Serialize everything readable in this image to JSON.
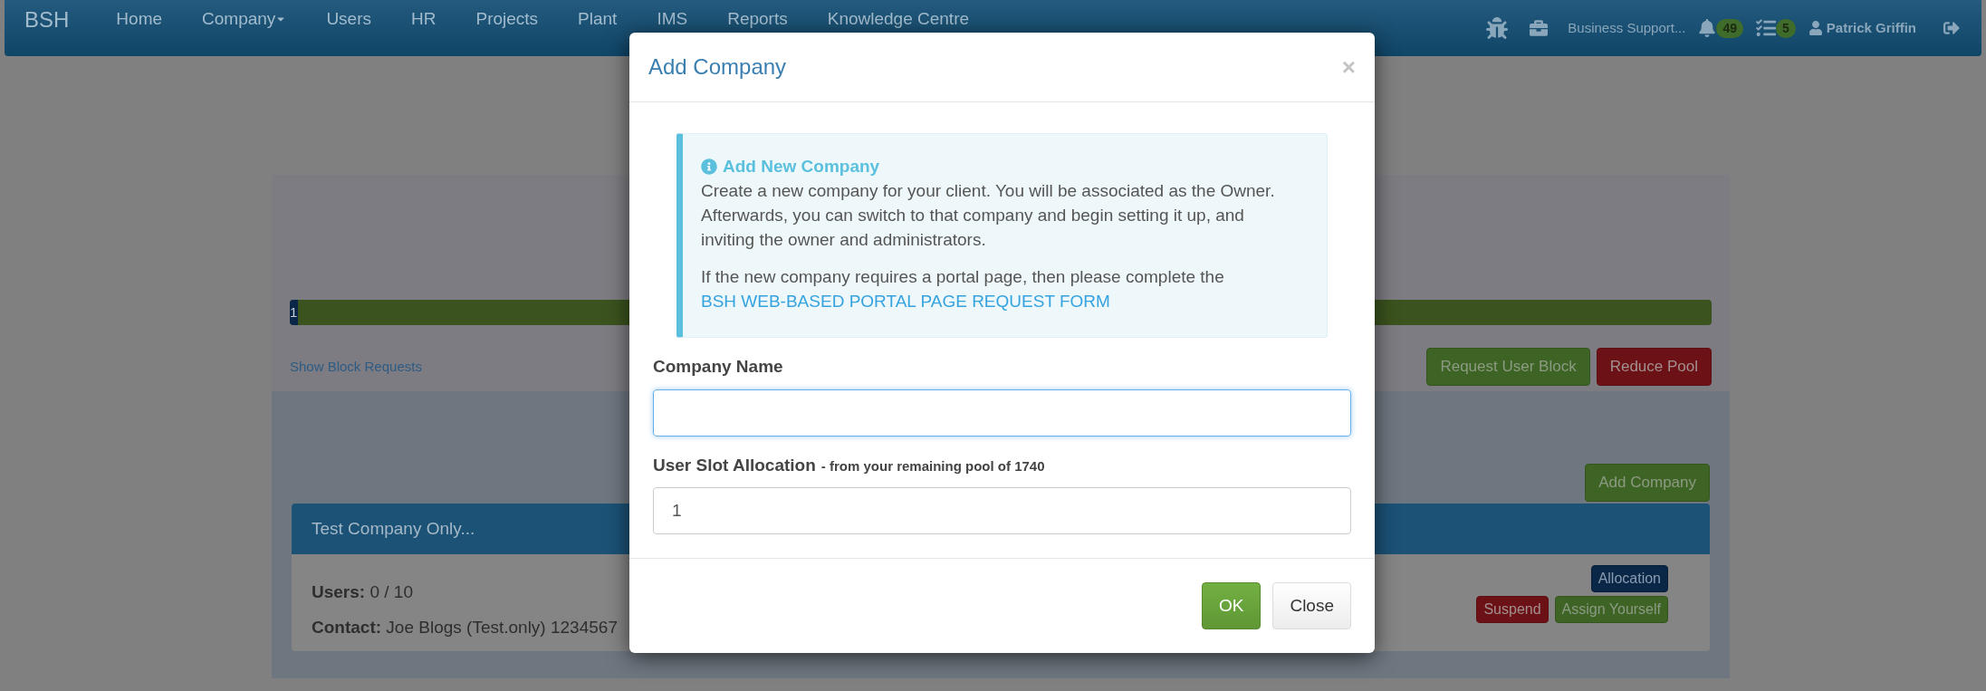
{
  "navbar": {
    "brand": "BSH",
    "items": [
      {
        "label": "Home",
        "dropdown": false
      },
      {
        "label": "Company",
        "dropdown": true
      },
      {
        "label": "Users",
        "dropdown": false
      },
      {
        "label": "HR",
        "dropdown": false
      },
      {
        "label": "Projects",
        "dropdown": false
      },
      {
        "label": "Plant",
        "dropdown": false
      },
      {
        "label": "IMS",
        "dropdown": false
      },
      {
        "label": "Reports",
        "dropdown": false
      },
      {
        "label": "Knowledge Centre",
        "dropdown": false
      }
    ],
    "business_unit": "Business Support...",
    "notifications_count": "49",
    "tasks_count": "5",
    "user": "Patrick Griffin"
  },
  "pool": {
    "bar_label": "1",
    "level": 0.006,
    "show_block_requests": "Show Block Requests",
    "buttons": [
      {
        "label": "Request User Block",
        "kind": "success"
      },
      {
        "label": "Reduce Pool",
        "kind": "danger"
      }
    ]
  },
  "companies": {
    "add_button": "Add Company",
    "cards": [
      {
        "title": "Test Company Only...",
        "users_label": "Users:",
        "users": "0 / 10",
        "contact_label": "Contact:",
        "contact": "Joe Blogs (Test.only) 1234567",
        "top_actions": [
          {
            "label": "Allocation",
            "kind": "primary"
          }
        ],
        "bottom_actions": [
          {
            "label": "Suspend",
            "kind": "danger"
          },
          {
            "label": "Assign Yourself",
            "kind": "success"
          }
        ]
      }
    ]
  },
  "modal": {
    "title": "Add Company",
    "close": "×",
    "info": {
      "title": "Add New Company",
      "text": "Create a new company for your client. You will be associated as the Owner. Afterwards, you can switch to that company and begin setting it up, and inviting the owner and administrators.",
      "text2": "If the new company requires a portal page, then please complete the",
      "link": "BSH WEB-BASED PORTAL PAGE REQUEST FORM"
    },
    "fields": [
      {
        "label": "Company Name",
        "focused": true
      },
      {
        "label": "User Slot Allocation",
        "hint": "- from your remaining pool of 1740",
        "value": "1",
        "focused": false
      }
    ],
    "buttons": [
      {
        "label": "OK",
        "kind": "success"
      },
      {
        "label": "Close",
        "kind": "default"
      }
    ]
  }
}
